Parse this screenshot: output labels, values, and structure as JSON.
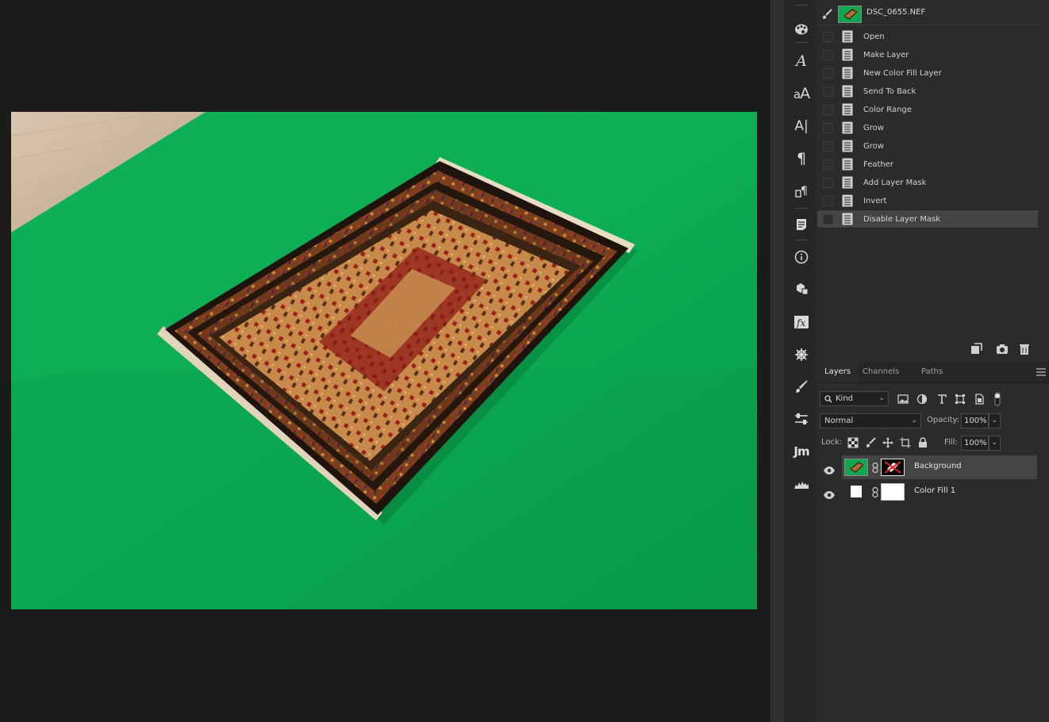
{
  "document": {
    "file_name": "DSC_0655.NEF"
  },
  "toolstrip": {
    "tools": [
      {
        "name": "grid-icon"
      },
      {
        "name": "color-palette-icon"
      },
      {
        "name": "glyphs-icon",
        "glyph": "A"
      },
      {
        "name": "character-styles-icon",
        "glyph": "aA"
      },
      {
        "name": "character-icon",
        "glyph": "A|"
      },
      {
        "name": "paragraph-icon",
        "glyph": "¶"
      },
      {
        "name": "paragraph-styles-icon",
        "glyph": "¶"
      },
      {
        "name": "notes-icon"
      },
      {
        "name": "info-icon",
        "glyph": "i"
      },
      {
        "name": "3d-icon"
      },
      {
        "name": "fx-icon",
        "glyph": "fx"
      },
      {
        "name": "navigator-wheel-icon"
      },
      {
        "name": "brush-icon"
      },
      {
        "name": "adjustments-icon"
      },
      {
        "name": "jm-plugin-icon",
        "glyph": "Jm"
      },
      {
        "name": "histogram-icon"
      }
    ]
  },
  "history": {
    "snapshot": {
      "name": "DSC_0655.NEF"
    },
    "items": [
      {
        "label": "Open"
      },
      {
        "label": "Make Layer"
      },
      {
        "label": "New Color Fill Layer"
      },
      {
        "label": "Send To Back"
      },
      {
        "label": "Color Range"
      },
      {
        "label": "Grow"
      },
      {
        "label": "Grow"
      },
      {
        "label": "Feather"
      },
      {
        "label": "Add Layer Mask"
      },
      {
        "label": "Invert"
      },
      {
        "label": "Disable Layer Mask"
      }
    ],
    "selected_index": 10
  },
  "layers_panel": {
    "tabs": [
      {
        "label": "Layers",
        "active": true
      },
      {
        "label": "Channels",
        "active": false
      },
      {
        "label": "Paths",
        "active": false
      }
    ],
    "filter": {
      "value": "Kind"
    },
    "blend_mode": {
      "value": "Normal"
    },
    "opacity": {
      "label": "Opacity:",
      "value": "100%"
    },
    "lock": {
      "label": "Lock:"
    },
    "fill": {
      "label": "Fill:",
      "value": "100%"
    },
    "layers": [
      {
        "name": "Background",
        "visible": true,
        "selected": true,
        "mask_disabled": true
      },
      {
        "name": "Color Fill 1",
        "visible": true,
        "selected": false,
        "fill_color": "#ffffff"
      }
    ]
  },
  "colors": {
    "green_screen": "#0ea851",
    "panel_bg": "#2b2b2b",
    "selected_row": "#444444"
  }
}
